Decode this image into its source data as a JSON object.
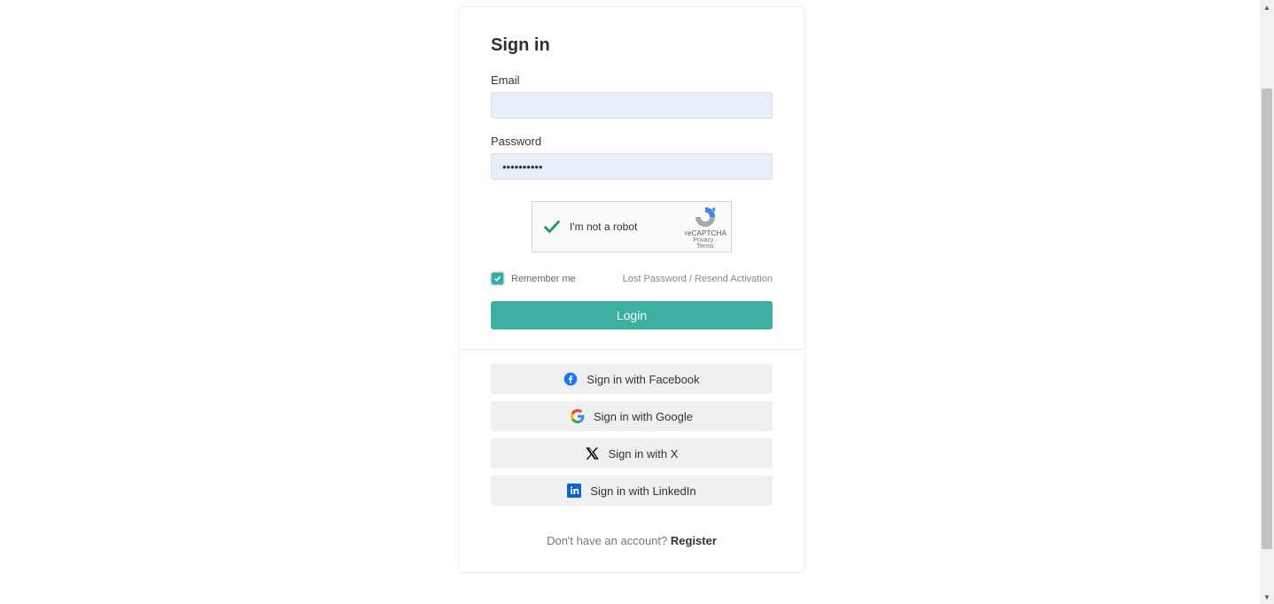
{
  "title": "Sign in",
  "email": {
    "label": "Email",
    "value": ""
  },
  "password": {
    "label": "Password",
    "value": "••••••••••"
  },
  "recaptcha": {
    "text": "I'm not a robot",
    "name": "reCAPTCHA",
    "privacy": "Privacy",
    "terms": "Terms",
    "checked": true
  },
  "remember": {
    "label": "Remember me",
    "checked": true
  },
  "links": {
    "lost_password": "Lost Password",
    "separator": " / ",
    "resend_activation": "Resend Activation"
  },
  "login_button": "Login",
  "social": {
    "facebook": "Sign in with Facebook",
    "google": "Sign in with Google",
    "x": "Sign in with X",
    "linkedin": "Sign in with LinkedIn"
  },
  "register": {
    "prompt": "Don't have an account? ",
    "link": "Register"
  }
}
